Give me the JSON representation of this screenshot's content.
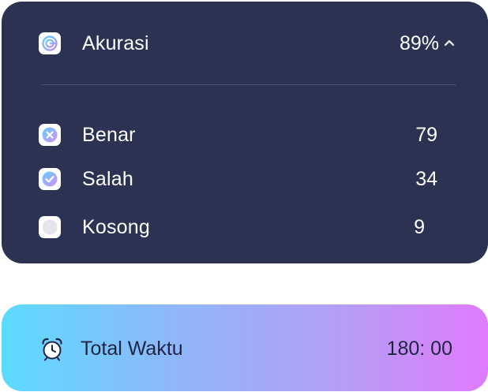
{
  "stats": {
    "accuracy": {
      "icon": "target-icon",
      "label": "Akurasi",
      "value": "89%"
    },
    "items": [
      {
        "icon": "cross-badge-icon",
        "label": "Benar",
        "value": "79"
      },
      {
        "icon": "check-badge-icon",
        "label": "Salah",
        "value": "34"
      },
      {
        "icon": "empty-circle-icon",
        "label": "Kosong",
        "value": "9"
      }
    ]
  },
  "time": {
    "icon": "alarm-clock-icon",
    "label": "Total Waktu",
    "value": "180: 00"
  },
  "colors": {
    "card_background": "#2c3352",
    "gradient_start": "#5cdbff",
    "gradient_end": "#e07bfb"
  }
}
